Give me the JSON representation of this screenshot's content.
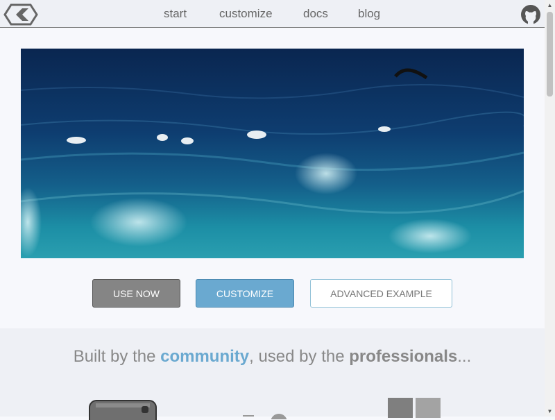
{
  "nav": {
    "items": [
      "start",
      "customize",
      "docs",
      "blog"
    ]
  },
  "actions": {
    "use_now": "USE NOW",
    "customize": "CUSTOMIZE",
    "advanced": "ADVANCED EXAMPLE"
  },
  "tagline": {
    "part1": "Built by the ",
    "community": "community",
    "part2": ", used by the ",
    "professionals": "professionals",
    "part3": "..."
  },
  "icons": {
    "logo": "hexagon-logo-icon",
    "github": "github-icon"
  },
  "colors": {
    "accent_blue": "#6aa9d0",
    "button_gray": "#858585"
  }
}
